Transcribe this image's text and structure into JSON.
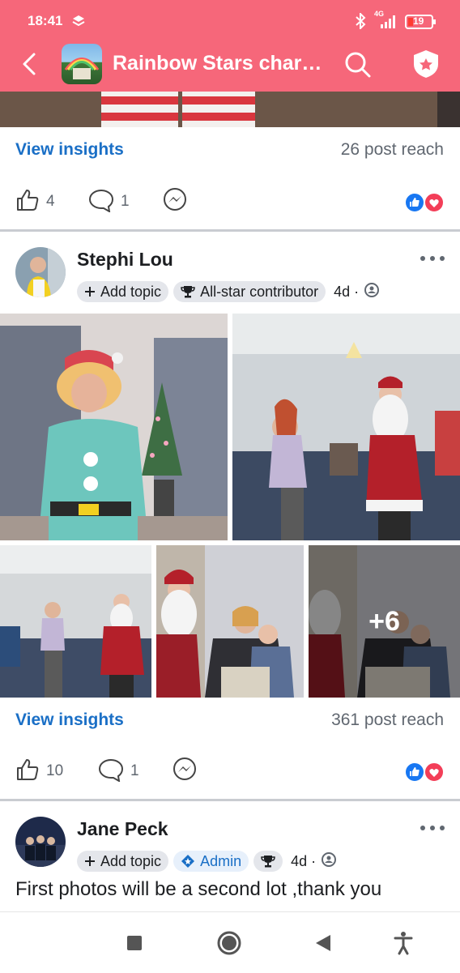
{
  "status_bar": {
    "time": "18:41",
    "network": "4G",
    "battery": "19"
  },
  "header": {
    "group_title": "Rainbow Stars chari…",
    "back_icon": "back-arrow-icon",
    "search_icon": "search-icon",
    "shield_icon": "admin-shield-icon",
    "bg_color": "#f6677a"
  },
  "previous_post": {
    "insights_label": "View insights",
    "reach": "26 post reach",
    "likes": "4",
    "comments": "1"
  },
  "post1": {
    "author": "Stephi Lou",
    "add_topic": "Add topic",
    "badge": "All-star contributor",
    "age": "4d ·",
    "more_photos": "+6",
    "insights_label": "View insights",
    "reach": "361 post reach",
    "likes": "10",
    "comments": "1"
  },
  "post2": {
    "author": "Jane Peck",
    "add_topic": "Add topic",
    "badge": "Admin",
    "age": "4d ·",
    "text": "First photos will be a second lot ,thank you"
  },
  "colors": {
    "link": "#1a6fc6",
    "like_blue": "#1877f2",
    "love_red": "#f33e58"
  }
}
